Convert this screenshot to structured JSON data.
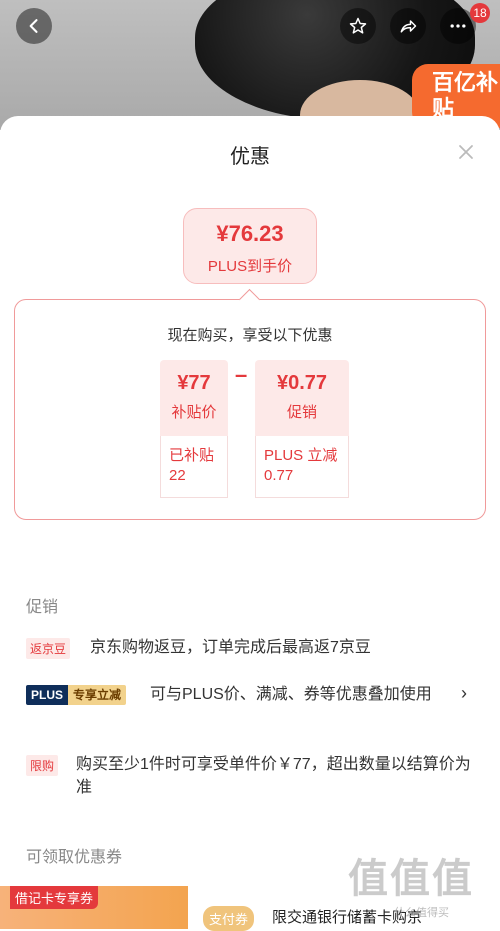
{
  "hero": {
    "cart_badge": "18",
    "promo_tag": "百亿补贴",
    "colors": {
      "accent": "#e4393c",
      "promo": "#f56a2f"
    }
  },
  "sheet": {
    "title": "优惠",
    "plus_price": "¥76.23",
    "plus_price_label": "PLUS到手价",
    "discount_title": "现在购买，享受以下优惠",
    "cards": [
      {
        "value": "¥77",
        "label": "补贴价",
        "detail_line1": "已补贴",
        "detail_line2": "22"
      },
      {
        "value": "¥0.77",
        "label": "促销",
        "detail_line1": "PLUS 立减",
        "detail_line2": "0.77"
      }
    ],
    "minus_sign": "–"
  },
  "promotions": {
    "section_label": "促销",
    "items": [
      {
        "tag": "返京豆",
        "text": "京东购物返豆，订单完成后最高返7京豆"
      },
      {
        "tag_left": "PLUS",
        "tag_right": "专享立减",
        "text": "可与PLUS价、满减、券等优惠叠加使用",
        "chevron": "›"
      },
      {
        "tag": "限购",
        "text": "购买至少1件时可享受单件价￥77，超出数量以结算价为准"
      }
    ]
  },
  "coupons": {
    "section_label": "可领取优惠券",
    "card_tag": "借记卡专享券",
    "pay_chip": "支付券",
    "description": "限交通银行储蓄卡购京"
  },
  "watermark": {
    "logo": "值值值",
    "url": "什么值得买"
  }
}
